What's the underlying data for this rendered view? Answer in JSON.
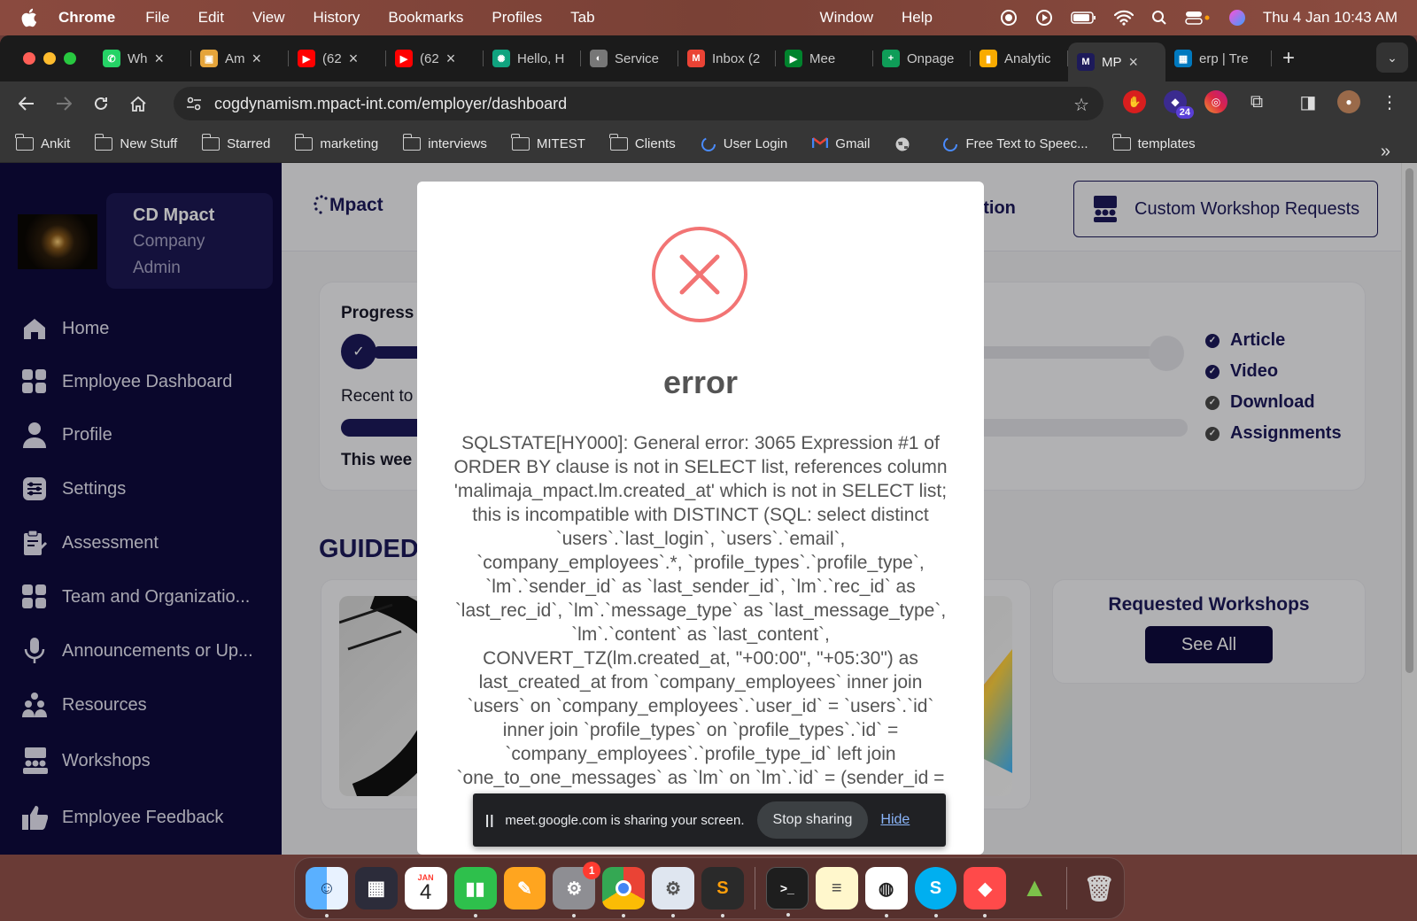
{
  "menubar": {
    "app": "Chrome",
    "items": [
      "File",
      "Edit",
      "View",
      "History",
      "Bookmarks",
      "Profiles",
      "Tab"
    ],
    "right_items": [
      "Window",
      "Help"
    ],
    "clock": "Thu 4 Jan  10:43 AM"
  },
  "tabs": [
    {
      "title": "Wh",
      "color": "#25d366",
      "glyph": "✆"
    },
    {
      "title": "Am",
      "color": "#e5a43a",
      "glyph": "▣"
    },
    {
      "title": "(62",
      "color": "#ff0000",
      "glyph": "▶"
    },
    {
      "title": "(62",
      "color": "#ff0000",
      "glyph": "▶"
    },
    {
      "title": "Hello, H",
      "color": "#10a37f",
      "glyph": "✺"
    },
    {
      "title": "Service",
      "color": "#777777",
      "glyph": "◐"
    },
    {
      "title": "Inbox (2",
      "color": "#ea4335",
      "glyph": "M"
    },
    {
      "title": "Mee",
      "color": "#00832d",
      "glyph": "▶"
    },
    {
      "title": "Onpage",
      "color": "#0f9d58",
      "glyph": "+"
    },
    {
      "title": "Analytic",
      "color": "#f9ab00",
      "glyph": "▮"
    },
    {
      "title": "MP",
      "color": "#1d1a5a",
      "glyph": "M",
      "active": true
    },
    {
      "title": "erp | Tre",
      "color": "#0079bf",
      "glyph": "▦"
    }
  ],
  "address": {
    "url": "cogdynamism.mpact-int.com/employer/dashboard"
  },
  "extensions": {
    "badge": "24"
  },
  "bookmarks": [
    {
      "label": "Ankit",
      "kind": "folder"
    },
    {
      "label": "New Stuff",
      "kind": "folder"
    },
    {
      "label": "Starred",
      "kind": "folder"
    },
    {
      "label": "marketing",
      "kind": "folder"
    },
    {
      "label": "interviews",
      "kind": "folder"
    },
    {
      "label": "MITEST",
      "kind": "folder"
    },
    {
      "label": "Clients",
      "kind": "folder"
    },
    {
      "label": "User Login",
      "kind": "link"
    },
    {
      "label": "Gmail",
      "kind": "gmail"
    },
    {
      "label": "",
      "kind": "globe"
    },
    {
      "label": "Free Text to Speec...",
      "kind": "link"
    },
    {
      "label": "templates",
      "kind": "folder"
    }
  ],
  "sidebar": {
    "user_name": "CD Mpact",
    "user_role": "Company Admin",
    "items": [
      {
        "label": "Home",
        "icon": "home-icon"
      },
      {
        "label": "Employee Dashboard",
        "icon": "grid-icon"
      },
      {
        "label": "Profile",
        "icon": "user-icon"
      },
      {
        "label": "Settings",
        "icon": "settings-icon"
      },
      {
        "label": "Assessment",
        "icon": "clipboard-icon"
      },
      {
        "label": "Team and Organizatio...",
        "icon": "grid-icon"
      },
      {
        "label": "Announcements or Up...",
        "icon": "mic-icon"
      },
      {
        "label": "Resources",
        "icon": "people-icon"
      },
      {
        "label": "Workshops",
        "icon": "workshop-icon"
      },
      {
        "label": "Employee Feedback",
        "icon": "thumbs-up-icon"
      }
    ]
  },
  "header": {
    "logo": "Mpact",
    "question_fragment": "estion",
    "custom_workshop_label": "Custom Workshop Requests"
  },
  "progress": {
    "title_fragment": "Progress",
    "recent_fragment": "Recent to",
    "week_fragment": "This wee",
    "legend": [
      {
        "label": "Article",
        "color": "#1d1a5a"
      },
      {
        "label": "Video",
        "color": "#1d1a5a"
      },
      {
        "label": "Download",
        "color": "#4a4a4a"
      },
      {
        "label": "Assignments",
        "color": "#4a4a4a"
      }
    ]
  },
  "guided": {
    "title_fragment": "GUIDED"
  },
  "requested": {
    "title": "Requested Workshops",
    "button": "See All"
  },
  "modal": {
    "title": "error",
    "message": "SQLSTATE[HY000]: General error: 3065 Expression #1 of ORDER BY clause is not in SELECT list, references column 'malimaja_mpact.lm.created_at' which is not in SELECT list; this is incompatible with DISTINCT (SQL: select distinct `users`.`last_login`, `users`.`email`, `company_employees`.*, `profile_types`.`profile_type`, `lm`.`sender_id` as `last_sender_id`, `lm`.`rec_id` as `last_rec_id`, `lm`.`message_type` as `last_message_type`, `lm`.`content` as `last_content`, CONVERT_TZ(lm.created_at, \"+00:00\", \"+05:30\") as last_created_at from `company_employees` inner join `users` on `company_employees`.`user_id` = `users`.`id` inner join `profile_types` on `profile_types`.`id` = `company_employees`.`profile_type_id` left join `one_to_one_messages` as `lm` on `lm`.`id` = (sender_id = company_employees.id OR rec_id ="
  },
  "sharebar": {
    "message": "meet.google.com is sharing your screen.",
    "stop_label": "Stop sharing",
    "hide_label": "Hide"
  },
  "dock": {
    "calendar_month": "JAN",
    "calendar_day": "4",
    "settings_badge": "1"
  }
}
